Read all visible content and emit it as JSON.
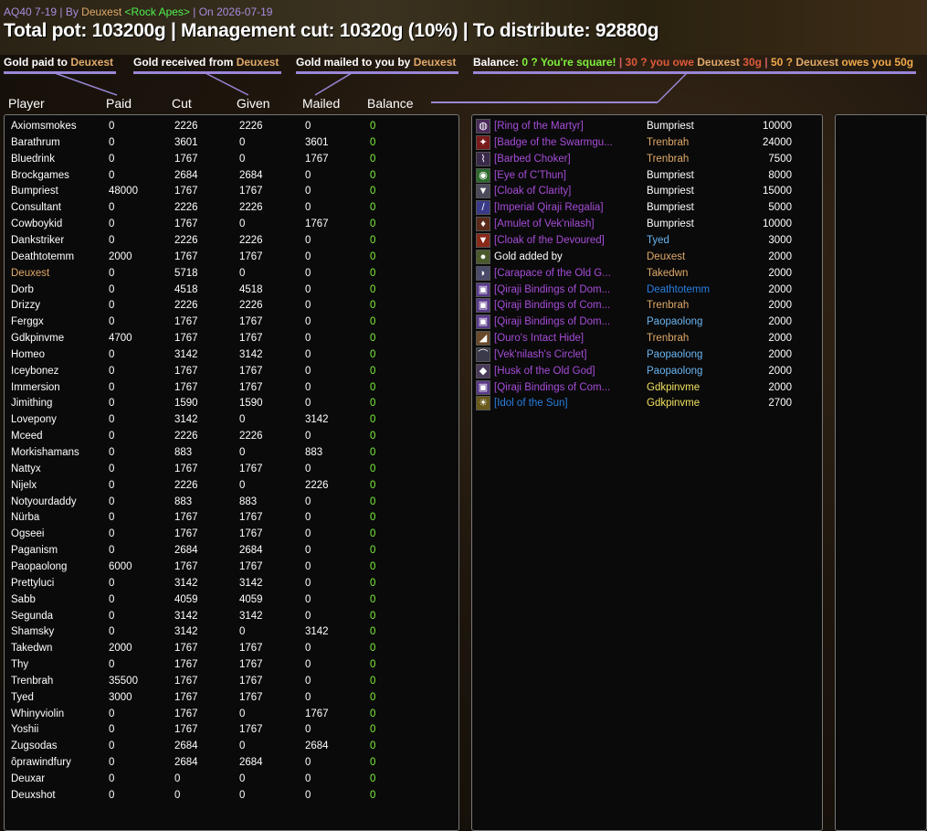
{
  "header": {
    "raid": "AQ40 7-19",
    "by_prefix": " | By ",
    "author": "Deuxest",
    "guild": "<Rock Apes>",
    "on_prefix": " | On ",
    "date": "2026-07-19",
    "title": "Total pot: 103200g | Management cut: 10320g (10%) | To distribute: 92880g"
  },
  "legend": {
    "paid_label": "Gold paid to",
    "paid_name": "Deuxest",
    "received_label": "Gold received from",
    "received_name": "Deuxest",
    "mailed_label": "Gold mailed to you by",
    "mailed_name": "Deuxest",
    "balance_label": "Balance:",
    "balance_square": "0 ? You're square!",
    "sep1": "|",
    "balance_owe_prefix": "30 ? you owe",
    "balance_owe_name": "Deuxest",
    "balance_owe_amount": "30g",
    "sep2": "|",
    "balance_owed_prefix": "50 ? ",
    "balance_owed_name": "Deuxest",
    "balance_owed_suffix": "owes you 50g"
  },
  "columns": {
    "player": "Player",
    "paid": "Paid",
    "cut": "Cut",
    "given": "Given",
    "mailed": "Mailed",
    "balance": "Balance"
  },
  "colors": {
    "accent_purple": "#9a86d6",
    "balance_green": "#7df03c",
    "epic_purple": "#a64cd8",
    "rare_blue": "#2a7fe0"
  },
  "players": [
    {
      "name": "Axiomsmokes",
      "paid": "0",
      "cut": "2226",
      "given": "2226",
      "mailed": "0",
      "balance": "0"
    },
    {
      "name": "Barathrum",
      "paid": "0",
      "cut": "3601",
      "given": "0",
      "mailed": "3601",
      "balance": "0"
    },
    {
      "name": "Bluedrink",
      "paid": "0",
      "cut": "1767",
      "given": "0",
      "mailed": "1767",
      "balance": "0"
    },
    {
      "name": "Brockgames",
      "paid": "0",
      "cut": "2684",
      "given": "2684",
      "mailed": "0",
      "balance": "0"
    },
    {
      "name": "Bumpriest",
      "paid": "48000",
      "cut": "1767",
      "given": "1767",
      "mailed": "0",
      "balance": "0"
    },
    {
      "name": "Consultant",
      "paid": "0",
      "cut": "2226",
      "given": "2226",
      "mailed": "0",
      "balance": "0"
    },
    {
      "name": "Cowboykid",
      "paid": "0",
      "cut": "1767",
      "given": "0",
      "mailed": "1767",
      "balance": "0"
    },
    {
      "name": "Dankstriker",
      "paid": "0",
      "cut": "2226",
      "given": "2226",
      "mailed": "0",
      "balance": "0"
    },
    {
      "name": "Deathtotemm",
      "paid": "2000",
      "cut": "1767",
      "given": "1767",
      "mailed": "0",
      "balance": "0"
    },
    {
      "name": "Deuxest",
      "paid": "0",
      "cut": "5718",
      "given": "0",
      "mailed": "0",
      "balance": "0",
      "me": true
    },
    {
      "name": "Dorb",
      "paid": "0",
      "cut": "4518",
      "given": "4518",
      "mailed": "0",
      "balance": "0"
    },
    {
      "name": "Drizzy",
      "paid": "0",
      "cut": "2226",
      "given": "2226",
      "mailed": "0",
      "balance": "0"
    },
    {
      "name": "Ferggx",
      "paid": "0",
      "cut": "1767",
      "given": "1767",
      "mailed": "0",
      "balance": "0"
    },
    {
      "name": "Gdkpinvme",
      "paid": "4700",
      "cut": "1767",
      "given": "1767",
      "mailed": "0",
      "balance": "0"
    },
    {
      "name": "Homeo",
      "paid": "0",
      "cut": "3142",
      "given": "3142",
      "mailed": "0",
      "balance": "0"
    },
    {
      "name": "Iceybonez",
      "paid": "0",
      "cut": "1767",
      "given": "1767",
      "mailed": "0",
      "balance": "0"
    },
    {
      "name": "Immersion",
      "paid": "0",
      "cut": "1767",
      "given": "1767",
      "mailed": "0",
      "balance": "0"
    },
    {
      "name": "Jimithing",
      "paid": "0",
      "cut": "1590",
      "given": "1590",
      "mailed": "0",
      "balance": "0"
    },
    {
      "name": "Lovepony",
      "paid": "0",
      "cut": "3142",
      "given": "0",
      "mailed": "3142",
      "balance": "0"
    },
    {
      "name": "Mceed",
      "paid": "0",
      "cut": "2226",
      "given": "2226",
      "mailed": "0",
      "balance": "0"
    },
    {
      "name": "Morkishamans",
      "paid": "0",
      "cut": "883",
      "given": "0",
      "mailed": "883",
      "balance": "0"
    },
    {
      "name": "Nattyx",
      "paid": "0",
      "cut": "1767",
      "given": "1767",
      "mailed": "0",
      "balance": "0"
    },
    {
      "name": "Nijelx",
      "paid": "0",
      "cut": "2226",
      "given": "0",
      "mailed": "2226",
      "balance": "0"
    },
    {
      "name": "Notyourdaddy",
      "paid": "0",
      "cut": "883",
      "given": "883",
      "mailed": "0",
      "balance": "0"
    },
    {
      "name": "Nürba",
      "paid": "0",
      "cut": "1767",
      "given": "1767",
      "mailed": "0",
      "balance": "0"
    },
    {
      "name": "Ogseei",
      "paid": "0",
      "cut": "1767",
      "given": "1767",
      "mailed": "0",
      "balance": "0"
    },
    {
      "name": "Paganism",
      "paid": "0",
      "cut": "2684",
      "given": "2684",
      "mailed": "0",
      "balance": "0"
    },
    {
      "name": "Paopaolong",
      "paid": "6000",
      "cut": "1767",
      "given": "1767",
      "mailed": "0",
      "balance": "0"
    },
    {
      "name": "Prettyluci",
      "paid": "0",
      "cut": "3142",
      "given": "3142",
      "mailed": "0",
      "balance": "0"
    },
    {
      "name": "Sabb",
      "paid": "0",
      "cut": "4059",
      "given": "4059",
      "mailed": "0",
      "balance": "0"
    },
    {
      "name": "Segunda",
      "paid": "0",
      "cut": "3142",
      "given": "3142",
      "mailed": "0",
      "balance": "0"
    },
    {
      "name": "Shamsky",
      "paid": "0",
      "cut": "3142",
      "given": "0",
      "mailed": "3142",
      "balance": "0"
    },
    {
      "name": "Takedwn",
      "paid": "2000",
      "cut": "1767",
      "given": "1767",
      "mailed": "0",
      "balance": "0"
    },
    {
      "name": "Thy",
      "paid": "0",
      "cut": "1767",
      "given": "1767",
      "mailed": "0",
      "balance": "0"
    },
    {
      "name": "Trenbrah",
      "paid": "35500",
      "cut": "1767",
      "given": "1767",
      "mailed": "0",
      "balance": "0"
    },
    {
      "name": "Tyed",
      "paid": "3000",
      "cut": "1767",
      "given": "1767",
      "mailed": "0",
      "balance": "0"
    },
    {
      "name": "Whinyviolin",
      "paid": "0",
      "cut": "1767",
      "given": "0",
      "mailed": "1767",
      "balance": "0"
    },
    {
      "name": "Yoshii",
      "paid": "0",
      "cut": "1767",
      "given": "1767",
      "mailed": "0",
      "balance": "0"
    },
    {
      "name": "Zugsodas",
      "paid": "0",
      "cut": "2684",
      "given": "0",
      "mailed": "2684",
      "balance": "0"
    },
    {
      "name": "ôprawindfury",
      "paid": "0",
      "cut": "2684",
      "given": "2684",
      "mailed": "0",
      "balance": "0"
    },
    {
      "name": "Deuxar",
      "paid": "0",
      "cut": "0",
      "given": "0",
      "mailed": "0",
      "balance": "0"
    },
    {
      "name": "Deuxshot",
      "paid": "0",
      "cut": "0",
      "given": "0",
      "mailed": "0",
      "balance": "0"
    }
  ],
  "loot": [
    {
      "item": "[Ring of the Martyr]",
      "winner": "Bumpriest",
      "price": "10000",
      "quality": "epic",
      "winner_color": "#ffffff",
      "icon": "ring-icon",
      "glyph": "◍",
      "icon_bg": "#4a2a5a"
    },
    {
      "item": "[Badge of the Swarmgu...",
      "winner": "Trenbrah",
      "price": "24000",
      "quality": "epic",
      "winner_color": "#e0a96a",
      "icon": "badge-icon",
      "glyph": "✦",
      "icon_bg": "#7a1a1a"
    },
    {
      "item": "[Barbed Choker]",
      "winner": "Trenbrah",
      "price": "7500",
      "quality": "epic",
      "winner_color": "#e0a96a",
      "icon": "necklace-icon",
      "glyph": "⌇",
      "icon_bg": "#3a2a4a"
    },
    {
      "item": "[Eye of C'Thun]",
      "winner": "Bumpriest",
      "price": "8000",
      "quality": "epic",
      "winner_color": "#ffffff",
      "icon": "eye-icon",
      "glyph": "◉",
      "icon_bg": "#2a6a2a"
    },
    {
      "item": "[Cloak of Clarity]",
      "winner": "Bumpriest",
      "price": "15000",
      "quality": "epic",
      "winner_color": "#ffffff",
      "icon": "cloak-icon",
      "glyph": "▼",
      "icon_bg": "#4a4a5a"
    },
    {
      "item": "[Imperial Qiraji Regalia]",
      "winner": "Bumpriest",
      "price": "5000",
      "quality": "epic",
      "winner_color": "#ffffff",
      "icon": "staff-icon",
      "glyph": "/",
      "icon_bg": "#3a3a8a"
    },
    {
      "item": "[Amulet of Vek'nilash]",
      "winner": "Bumpriest",
      "price": "10000",
      "quality": "epic",
      "winner_color": "#ffffff",
      "icon": "amulet-icon",
      "glyph": "♦",
      "icon_bg": "#5a2a1a"
    },
    {
      "item": "[Cloak of the Devoured]",
      "winner": "Tyed",
      "price": "3000",
      "quality": "epic",
      "winner_color": "#6ab4f0",
      "icon": "cloak-icon",
      "glyph": "▼",
      "icon_bg": "#8a2a1a"
    },
    {
      "item": "Gold added by",
      "winner": "Deuxest",
      "price": "2000",
      "quality": "plain",
      "winner_color": "#e0a96a",
      "icon": "gold-icon",
      "glyph": "●",
      "icon_bg": "#4a5a2a"
    },
    {
      "item": "[Carapace of the Old G...",
      "winner": "Takedwn",
      "price": "2000",
      "quality": "epic",
      "winner_color": "#e0a96a",
      "icon": "carapace-icon",
      "glyph": "◗",
      "icon_bg": "#4a4a6a"
    },
    {
      "item": "[Qiraji Bindings of Dom...",
      "winner": "Deathtotemm",
      "price": "2000",
      "quality": "epic",
      "winner_color": "#2a7fe0",
      "icon": "bindings-icon",
      "glyph": "▣",
      "icon_bg": "#5a3a8a"
    },
    {
      "item": "[Qiraji Bindings of Com...",
      "winner": "Trenbrah",
      "price": "2000",
      "quality": "epic",
      "winner_color": "#e0a96a",
      "icon": "bindings-icon",
      "glyph": "▣",
      "icon_bg": "#5a3a8a"
    },
    {
      "item": "[Qiraji Bindings of Dom...",
      "winner": "Paopaolong",
      "price": "2000",
      "quality": "epic",
      "winner_color": "#6ab4f0",
      "icon": "bindings-icon",
      "glyph": "▣",
      "icon_bg": "#5a3a8a"
    },
    {
      "item": "[Ouro's Intact Hide]",
      "winner": "Trenbrah",
      "price": "2000",
      "quality": "epic",
      "winner_color": "#e0a96a",
      "icon": "hide-icon",
      "glyph": "◢",
      "icon_bg": "#6a4a2a"
    },
    {
      "item": "[Vek'nilash's Circlet]",
      "winner": "Paopaolong",
      "price": "2000",
      "quality": "epic",
      "winner_color": "#6ab4f0",
      "icon": "circlet-icon",
      "glyph": "⌒",
      "icon_bg": "#3a3a4a"
    },
    {
      "item": "[Husk of the Old God]",
      "winner": "Paopaolong",
      "price": "2000",
      "quality": "epic",
      "winner_color": "#6ab4f0",
      "icon": "husk-icon",
      "glyph": "◆",
      "icon_bg": "#4a3a5a"
    },
    {
      "item": "[Qiraji Bindings of Com...",
      "winner": "Gdkpinvme",
      "price": "2000",
      "quality": "epic",
      "winner_color": "#f0e060",
      "icon": "bindings-icon",
      "glyph": "▣",
      "icon_bg": "#5a3a8a"
    },
    {
      "item": "[Idol of the Sun]",
      "winner": "Gdkpinvme",
      "price": "2700",
      "quality": "rare",
      "winner_color": "#f0e060",
      "icon": "idol-icon",
      "glyph": "☀",
      "icon_bg": "#6a5a1a"
    }
  ]
}
